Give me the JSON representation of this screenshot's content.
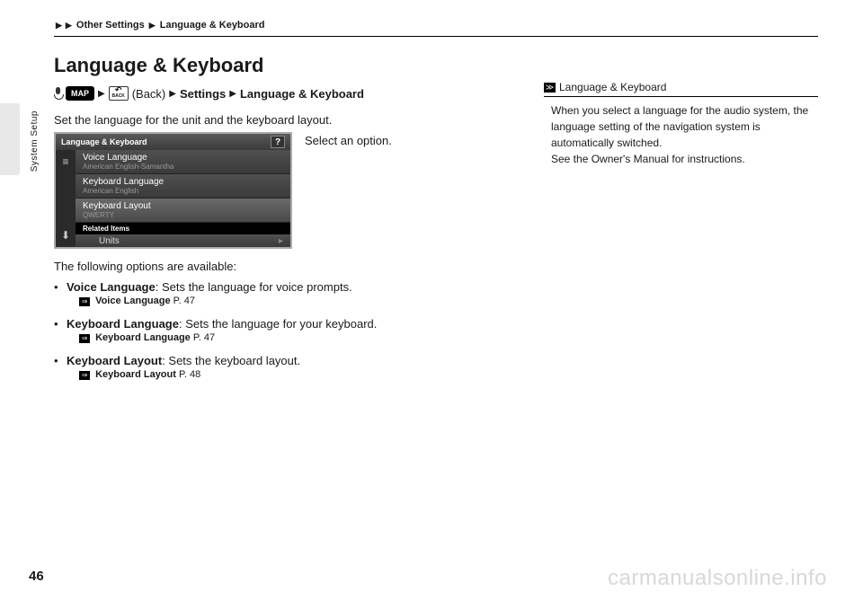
{
  "breadcrumb": {
    "item1": "Other Settings",
    "item2": "Language & Keyboard"
  },
  "sideLabel": "System Setup",
  "heading": "Language & Keyboard",
  "navPath": {
    "map": "MAP",
    "backBtn": "BACK",
    "backText": "(Back)",
    "settings": "Settings",
    "final": "Language & Keyboard"
  },
  "intro": "Set the language for the unit and the keyboard layout.",
  "instruction": "Select an option.",
  "screenshot": {
    "title": "Language & Keyboard",
    "items": [
      {
        "label": "Voice Language",
        "sub": "American English-Samantha"
      },
      {
        "label": "Keyboard Language",
        "sub": "American English"
      },
      {
        "label": "Keyboard Layout",
        "sub": "QWERTY"
      }
    ],
    "related": "Related Items",
    "units": "Units"
  },
  "optionsIntro": "The following options are available:",
  "options": [
    {
      "title": "Voice Language",
      "desc": ": Sets the language for voice prompts.",
      "xrefLabel": "Voice Language",
      "xrefPage": "P. 47"
    },
    {
      "title": "Keyboard Language",
      "desc": ": Sets the language for your keyboard.",
      "xrefLabel": "Keyboard Language",
      "xrefPage": "P. 47"
    },
    {
      "title": "Keyboard Layout",
      "desc": ": Sets the keyboard layout.",
      "xrefLabel": "Keyboard Layout",
      "xrefPage": "P. 48"
    }
  ],
  "noteTitle": "Language & Keyboard",
  "noteBody1": "When you select a language for the audio system, the language setting of the navigation system is automatically switched.",
  "noteBody2": "See the Owner's Manual for instructions.",
  "pageNum": "46",
  "watermark": "carmanualsonline.info"
}
